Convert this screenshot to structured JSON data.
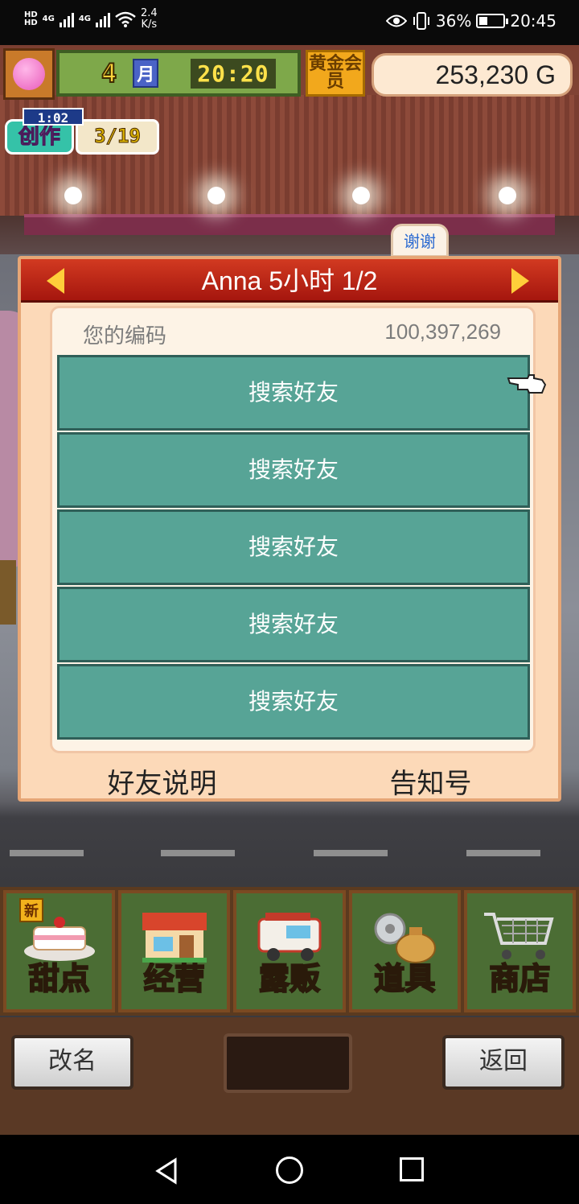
{
  "status_bar": {
    "hd1": "HD",
    "hd2": "HD",
    "net1": "4G",
    "net2": "4G",
    "speed_value": "2.4",
    "speed_unit": "K/s",
    "battery": "36%",
    "time": "20:45"
  },
  "hud": {
    "month": "4",
    "month_unit": "月",
    "clock": "20:20",
    "gold_member": "黄金会员",
    "money": "253,230 G",
    "create_timer": "1:02",
    "create_label": "创作",
    "create_count": "3/19"
  },
  "thanks_tab": "谢谢",
  "dialog": {
    "title": "Anna  5小时 1/2",
    "code_label": "您的编码",
    "code_value": "100,397,269",
    "slots": [
      "搜索好友",
      "搜索好友",
      "搜索好友",
      "搜索好友",
      "搜索好友"
    ],
    "footer_left": "好友说明",
    "footer_right": "告知号"
  },
  "menu": {
    "new_badge": "新",
    "items": [
      "甜点",
      "经营",
      "露贩",
      "道具",
      "商店"
    ]
  },
  "bottom": {
    "rename": "改名",
    "back": "返回"
  },
  "icons": {
    "prev": "left-arrow-icon",
    "next": "right-arrow-icon",
    "pointer": "pointing-hand-icon"
  },
  "colors": {
    "header_red": "#c7281a",
    "slot_teal": "#57a496",
    "dialog_bg": "#fcd9b8",
    "arrow_yellow": "#ffce3a"
  }
}
